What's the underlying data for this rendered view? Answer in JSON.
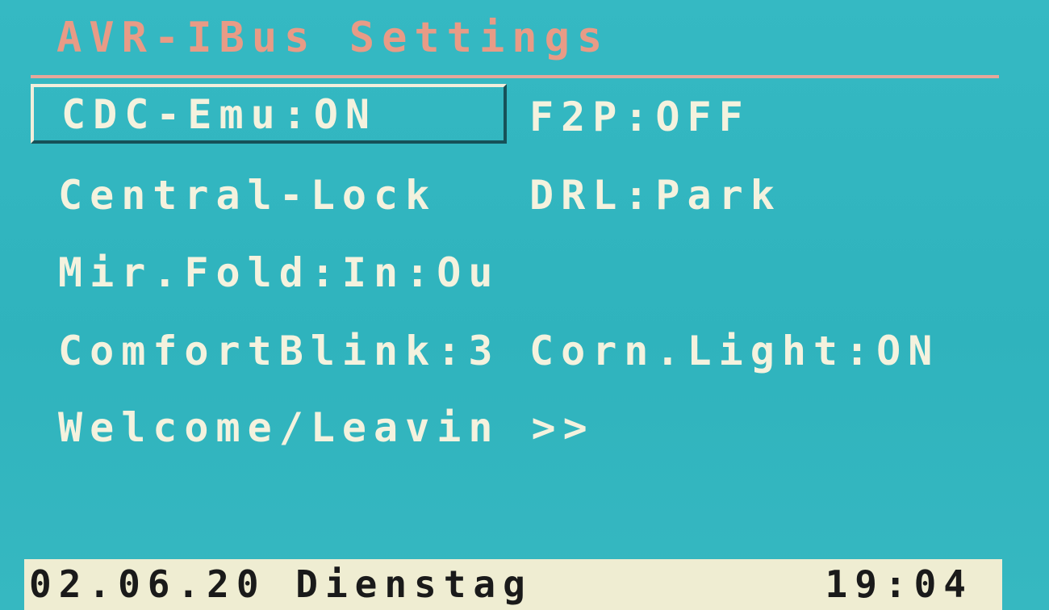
{
  "header": {
    "title": "AVR-IBus Settings"
  },
  "menu": {
    "cdc_emu": "CDC-Emu:ON",
    "f2p": "F2P:OFF",
    "central_lock": "Central-Lock",
    "drl": "DRL:Park",
    "mirror_fold": "Mir.Fold:In:Ou",
    "comfort_blink": "ComfortBlink:3",
    "corner_light": "Corn.Light:ON",
    "welcome_leaving": "Welcome/Leavin >>",
    "selected_item": "CDC-Emu:ON"
  },
  "status_bar": {
    "date": "02.06.20 Dienstag",
    "time": "19:04"
  },
  "colors": {
    "screen_background": "#2fb4bf",
    "title_text": "#e89b86",
    "menu_text": "#f4f2de",
    "status_bar_background": "#efedd2",
    "status_bar_text": "#1a1a1a"
  }
}
